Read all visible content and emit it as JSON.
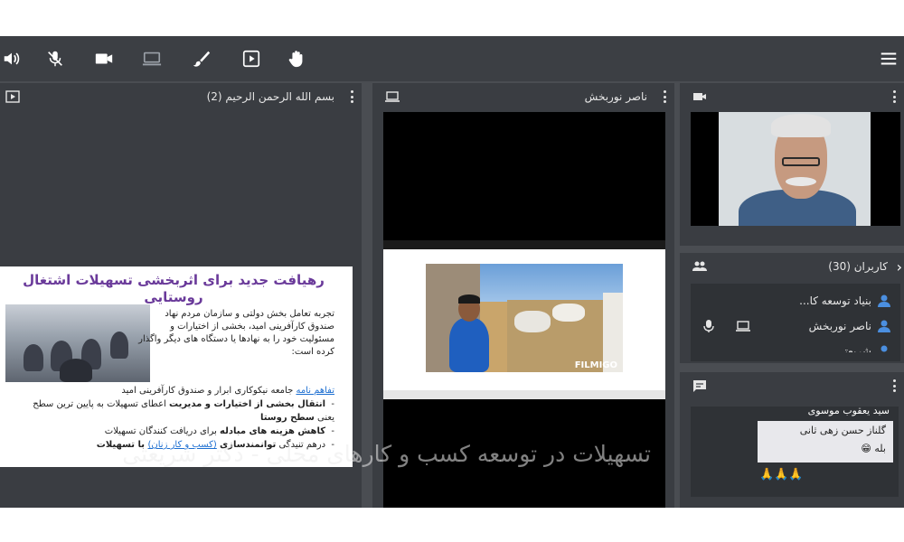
{
  "toolbar": {
    "icons": [
      "speaker-icon",
      "mic-muted-icon",
      "camera-icon",
      "screen-share-icon",
      "brush-icon",
      "media-play-icon",
      "raise-hand-icon",
      "menu-icon"
    ]
  },
  "presentation_panel": {
    "title": "بسم الله الرحمن الرحیم (2)"
  },
  "slide": {
    "title": "رهیافت جدید برای اثربخشی تسهیلات اشتغال روستایی",
    "para": "تجربه تعامل بخش دولتی و سازمان مردم نهاد صندوق کارآفرینی امید، بخشی از اختیارات و مسئولیت خود را به نهادها یا دستگاه های دیگر واگذار کرده است:",
    "link": "تفاهم نامه",
    "line1_rest": " جامعه نیکوکاری ابرار و صندوق کارآفرینی امید",
    "bullet1_strong": "انتقال بخشی از اختیارات و مدیریت",
    "bullet1_rest": " اعطای تسهیلات به پایین ترین سطح یعنی ",
    "bullet1_end": "سطح روستا",
    "bullet2_strong": "کاهش هزینه های مبادله",
    "bullet2_rest": " برای دریافت کنندگان تسهیلات",
    "bullet3_start": "درهم تنیدگی ",
    "bullet3_strong": "توانمندسازی",
    "bullet3_link": "(کسب و کار زنان)",
    "bullet3_end": " با تسهیلات"
  },
  "caption": "تسهیلات در توسعه کسب و کارهای محلی - دکتر شریعتی",
  "screen_panel": {
    "title": "ناصر نوربخش",
    "watermark": "FILMIGO"
  },
  "users_panel": {
    "title": "کاربران (30)",
    "users": [
      "بنیاد توسعه کا...",
      "ناصر نوربخش",
      "شریعتی"
    ]
  },
  "chat": {
    "sender": "سید یعقوب موسوی",
    "msg_name": "گلناز حسن زهی ثانی",
    "msg_text": "بله 😁",
    "reactions": "🙏🙏🙏"
  },
  "colors": {
    "frame_bg": "#4a4d52",
    "panel_bg": "#3a3d42",
    "toolbar_bg": "#3c3f44",
    "slide_title": "#6a3a9a",
    "link": "#1d6fd1"
  }
}
